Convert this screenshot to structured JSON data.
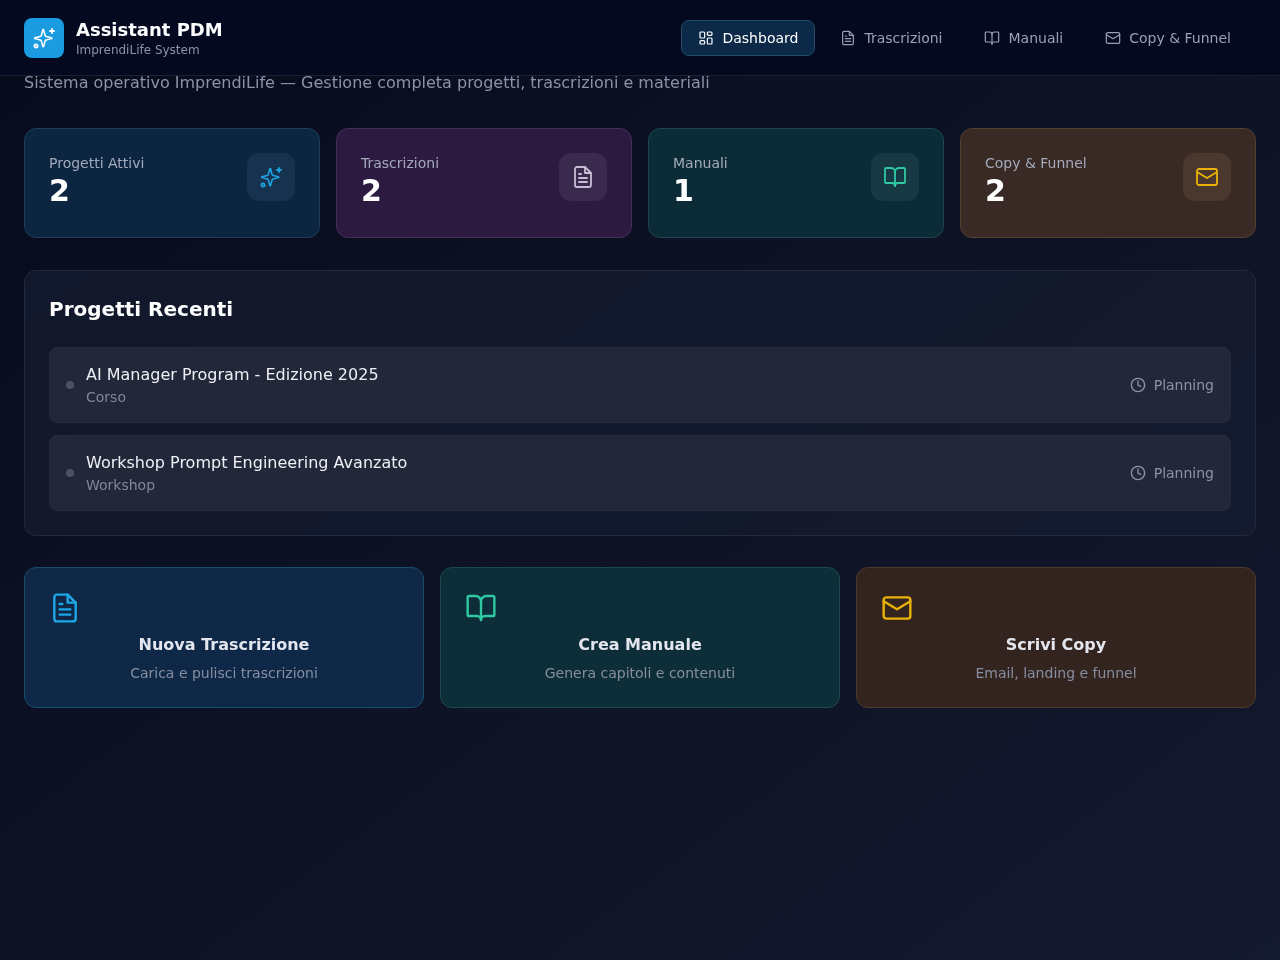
{
  "app": {
    "title": "Assistant PDM",
    "subtitle": "ImprendiLife System"
  },
  "nav": [
    {
      "label": "Dashboard",
      "kind": "dashboard",
      "selected": true
    },
    {
      "label": "Trascrizioni",
      "kind": "transcripts",
      "selected": false
    },
    {
      "label": "Manuali",
      "kind": "manuals",
      "selected": false
    },
    {
      "label": "Copy & Funnel",
      "kind": "copy",
      "selected": false
    }
  ],
  "page_description": "Sistema operativo ImprendiLife — Gestione completa progetti, trascrizioni e materiali",
  "stats": [
    {
      "label": "Progetti Attivi",
      "value": "2",
      "kind": "projects"
    },
    {
      "label": "Trascrizioni",
      "value": "2",
      "kind": "transcripts"
    },
    {
      "label": "Manuali",
      "value": "1",
      "kind": "manuals"
    },
    {
      "label": "Copy & Funnel",
      "value": "2",
      "kind": "copy"
    }
  ],
  "recent_projects": {
    "title": "Progetti Recenti",
    "items": [
      {
        "name": "AI Manager Program - Edizione 2025",
        "type": "Corso",
        "status": "Planning"
      },
      {
        "name": "Workshop Prompt Engineering Avanzato",
        "type": "Workshop",
        "status": "Planning"
      }
    ]
  },
  "actions": [
    {
      "title": "Nuova Trascrizione",
      "description": "Carica e pulisci trascrizioni",
      "kind": "transcripts"
    },
    {
      "title": "Crea Manuale",
      "description": "Genera capitoli e contenuti",
      "kind": "manuals"
    },
    {
      "title": "Scrivi Copy",
      "description": "Email, landing e funnel",
      "kind": "copy"
    }
  ]
}
